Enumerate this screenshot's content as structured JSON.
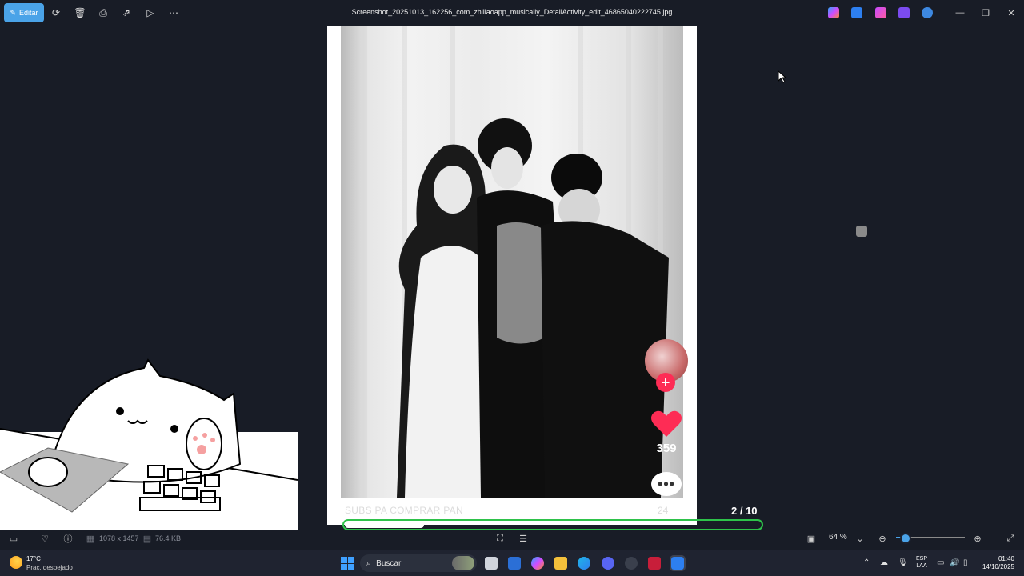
{
  "toolbar": {
    "edit_label": "Editar",
    "file_title": "Screenshot_20251013_162256_com_zhiliaoapp_musically_DetailActivity_edit_46865040222745.jpg",
    "icons": [
      "rotate-icon",
      "delete-icon",
      "print-icon",
      "share-icon",
      "slideshow-icon",
      "more-icon"
    ],
    "window_controls": [
      "minimize-icon",
      "restore-icon",
      "close-icon"
    ]
  },
  "viewer": {
    "caption": "SUBS PA COMPRAR PAN",
    "caption_number": "24",
    "counter": "2  / 10",
    "video_progress": 0.19,
    "like_count": "359"
  },
  "statusbar": {
    "dimensions": "1078 x 1457",
    "file_size": "76.4 KB",
    "zoom": "64 %",
    "zoom_fraction": 0.1
  },
  "taskbar": {
    "weather_temp": "17°C",
    "weather_desc": "Prac. despejado",
    "search_label": "Buscar",
    "lang_line1": "ESP",
    "lang_line2": "LAA",
    "time": "01:40",
    "date": "14/10/2025"
  },
  "colors": {
    "accent": "#4aa3e8",
    "progress_outline": "#2ec24a",
    "like": "#fe2c55"
  }
}
